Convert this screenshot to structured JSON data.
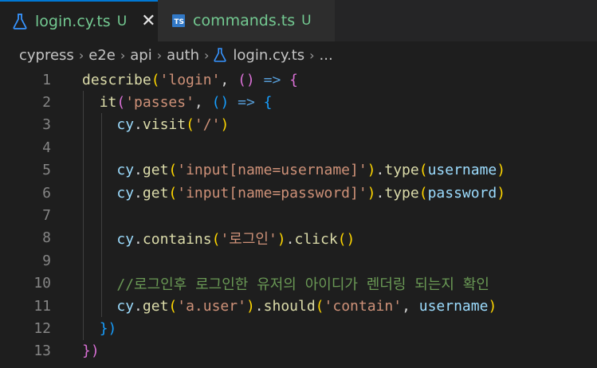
{
  "tabs": [
    {
      "label": "login.cy.ts",
      "status": "U",
      "icon": "flask-icon",
      "active": true
    },
    {
      "label": "commands.ts",
      "status": "U",
      "icon": "typescript-icon",
      "active": false
    }
  ],
  "ts_icon_text": "TS",
  "close_glyph": "✕",
  "breadcrumb": {
    "items": [
      "cypress",
      "e2e",
      "api",
      "auth",
      "login.cy.ts",
      "..."
    ],
    "separator": "›"
  },
  "line_numbers": [
    "1",
    "2",
    "3",
    "4",
    "5",
    "6",
    "7",
    "8",
    "9",
    "10",
    "11",
    "12",
    "13"
  ],
  "code": {
    "l1": [
      "describe",
      "(",
      "'login'",
      ", ",
      "()",
      " => ",
      "{"
    ],
    "l2": [
      "it",
      "(",
      "'passes'",
      ", ",
      "()",
      " => ",
      "{"
    ],
    "l3": [
      "cy",
      ".",
      "visit",
      "(",
      "'/'",
      ")"
    ],
    "l5": [
      "cy",
      ".",
      "get",
      "(",
      "'input[name=username]'",
      ")",
      ".",
      "type",
      "(",
      "username",
      ")"
    ],
    "l6": [
      "cy",
      ".",
      "get",
      "(",
      "'input[name=password]'",
      ")",
      ".",
      "type",
      "(",
      "password",
      ")"
    ],
    "l8": [
      "cy",
      ".",
      "contains",
      "(",
      "'로그인'",
      ")",
      ".",
      "click",
      "()"
    ],
    "l10": [
      "//로그인후 로그인한 유저의 아이디가 렌더링 되는지 확인"
    ],
    "l11": [
      "cy",
      ".",
      "get",
      "(",
      "'a.user'",
      ")",
      ".",
      "should",
      "(",
      "'contain'",
      ", ",
      "username",
      ")"
    ],
    "l12": [
      "})"
    ],
    "l13": [
      "})"
    ]
  },
  "colors": {
    "accent": "#0078d4",
    "untracked": "#73c991",
    "keyword_function": "#dcdcaa",
    "string": "#ce9178",
    "variable": "#9cdcfe",
    "arrow": "#569cd6",
    "comment": "#6a9955"
  }
}
